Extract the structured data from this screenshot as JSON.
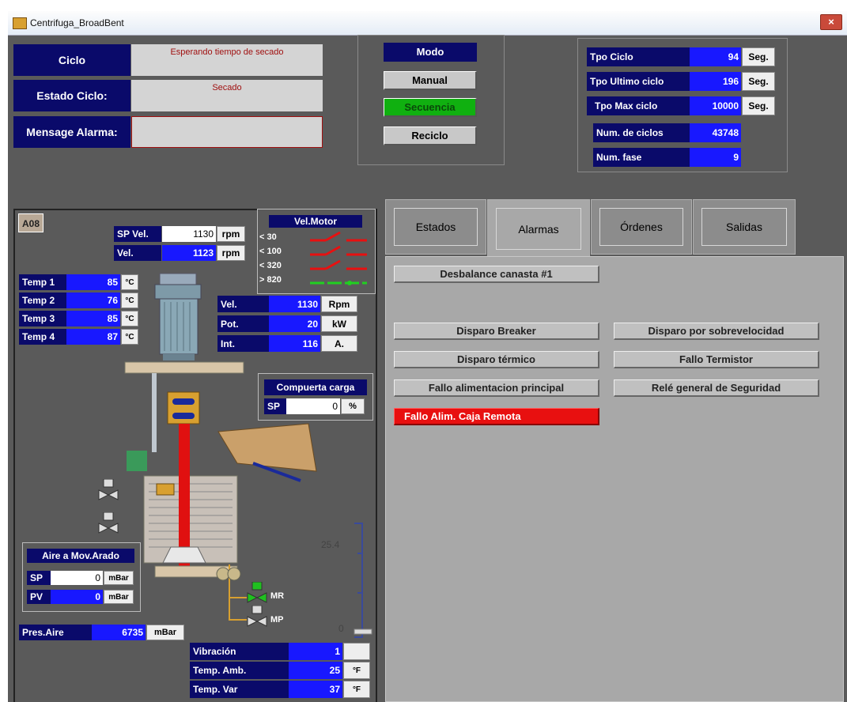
{
  "window": {
    "title": "Centrifuga_BroadBent",
    "close": "×"
  },
  "status": {
    "ciclo_label": "Ciclo",
    "ciclo_value": "Esperando tiempo de secado",
    "estado_label": "Estado Ciclo:",
    "estado_value": "Secado",
    "alarma_label": "Mensage Alarma:",
    "alarma_value": ""
  },
  "mode": {
    "title": "Modo",
    "manual": "Manual",
    "secuencia": "Secuencia",
    "reciclo": "Reciclo"
  },
  "times": {
    "tpo_ciclo": {
      "label": "Tpo Ciclo",
      "value": "94",
      "unit": "Seg."
    },
    "tpo_ultimo": {
      "label": "Tpo Ultimo ciclo",
      "value": "196",
      "unit": "Seg."
    },
    "tpo_max": {
      "label": "Tpo Max ciclo",
      "value": "10000",
      "unit": "Seg."
    },
    "num_ciclos": {
      "label": "Num. de ciclos",
      "value": "43748"
    },
    "num_fase": {
      "label": "Num. fase",
      "value": "9"
    }
  },
  "machine": {
    "id": "A08",
    "sp_vel": {
      "label": "SP Vel.",
      "value": "1130",
      "unit": "rpm"
    },
    "vel": {
      "label": "Vel.",
      "value": "1123",
      "unit": "rpm"
    },
    "temps": [
      {
        "label": "Temp 1",
        "value": "85",
        "unit": "°C"
      },
      {
        "label": "Temp 2",
        "value": "76",
        "unit": "°C"
      },
      {
        "label": "Temp 3",
        "value": "85",
        "unit": "°C"
      },
      {
        "label": "Temp 4",
        "value": "87",
        "unit": "°C"
      }
    ],
    "vel_motor": {
      "title": "Vel.Motor",
      "levels": [
        "< 30",
        "< 100",
        "< 320",
        "> 820"
      ]
    },
    "motor": {
      "vel": {
        "label": "Vel.",
        "value": "1130",
        "unit": "Rpm"
      },
      "pot": {
        "label": "Pot.",
        "value": "20",
        "unit": "kW"
      },
      "int": {
        "label": "Int.",
        "value": "116",
        "unit": "A."
      }
    },
    "compuerta": {
      "title": "Compuerta carga",
      "sp_label": "SP",
      "sp_value": "0",
      "unit": "%"
    },
    "aire": {
      "title": "Aire a Mov.Arado",
      "sp_label": "SP",
      "sp_value": "0",
      "pv_label": "PV",
      "pv_value": "0",
      "unit": "mBar"
    },
    "pres_aire": {
      "label": "Pres.Aire",
      "value": "6735",
      "unit": "mBar"
    },
    "scale": {
      "top": "25.4",
      "bottom": "0"
    },
    "valves": {
      "mr": "MR",
      "mp": "MP"
    },
    "vibracion": {
      "label": "Vibración",
      "value": "1",
      "unit": ""
    },
    "temp_amb": {
      "label": "Temp. Amb.",
      "value": "25",
      "unit": "°F"
    },
    "temp_var": {
      "label": "Temp. Var",
      "value": "37",
      "unit": "°F"
    }
  },
  "tabs": [
    "Estados",
    "Alarmas",
    "Órdenes",
    "Salidas"
  ],
  "alarms": {
    "desbalance": "Desbalance canasta #1",
    "disparo_breaker": "Disparo Breaker",
    "disparo_sobrevel": "Disparo por sobrevelocidad",
    "disparo_termico": "Disparo térmico",
    "fallo_termistor": "Fallo Termistor",
    "fallo_alim": "Fallo alimentacion principal",
    "rele": "Relé general de Seguridad",
    "fallo_caja": "Fallo Alim. Caja Remota"
  },
  "colors": {
    "active_alarm": "#e81010",
    "mode_active": "#10b010",
    "value_blue": "#1818ff",
    "label_navy": "#0a0a6a"
  }
}
